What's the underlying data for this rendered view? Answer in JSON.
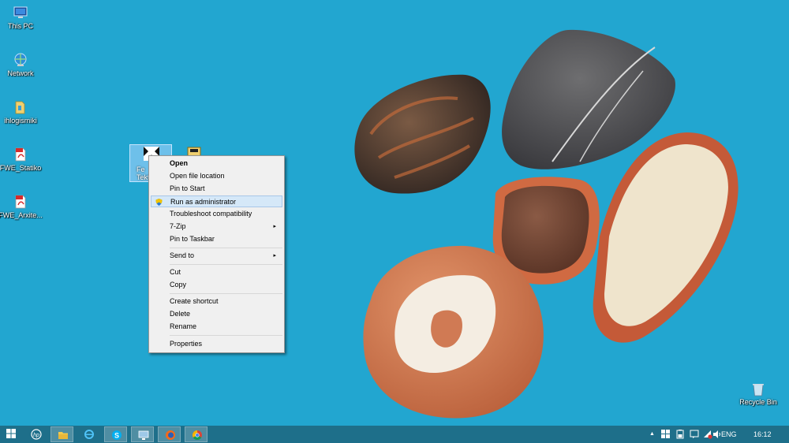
{
  "desktop": {
    "icons": [
      {
        "label": "This PC",
        "icon": "this-pc-icon"
      },
      {
        "label": "Network",
        "icon": "network-icon"
      },
      {
        "label": "ihlogismiki",
        "icon": "folder-icon"
      },
      {
        "label": "FWE_Statiko",
        "icon": "pdf-icon"
      },
      {
        "label": "FWE_Arxite...",
        "icon": "pdf-icon"
      }
    ],
    "selected_label_line1": "Fe",
    "selected_label_line2": "Tekto",
    "recycle_bin_label": "Recycle Bin"
  },
  "context_menu": {
    "items": [
      {
        "label": "Open",
        "bold": true
      },
      {
        "label": "Open file location"
      },
      {
        "label": "Pin to Start"
      },
      {
        "label": "Run as administrator",
        "highlighted": true,
        "icon": "uac-shield-icon"
      },
      {
        "label": "Troubleshoot compatibility"
      },
      {
        "label": "7-Zip",
        "submenu": true
      },
      {
        "label": "Pin to Taskbar"
      },
      {
        "label": "Send to",
        "submenu": true
      },
      {
        "label": "Cut"
      },
      {
        "label": "Copy"
      },
      {
        "label": "Create shortcut"
      },
      {
        "label": "Delete"
      },
      {
        "label": "Rename"
      },
      {
        "label": "Properties"
      }
    ],
    "submenu_arrow": "▸"
  },
  "taskbar": {
    "pinned": [
      "start-icon",
      "hp-icon",
      "file-explorer-icon",
      "ie-icon",
      "skype-icon",
      "network-monitor-icon",
      "firefox-icon",
      "chrome-icon"
    ],
    "tray": {
      "up_arrow": "▲",
      "language": "ENG",
      "time": "16:12"
    }
  },
  "colors": {
    "desktop_bg": "#22a6d0",
    "taskbar_bg": "#1e6f8a",
    "menu_bg": "#f0f0f0",
    "menu_highlight": "#d5e8f8"
  }
}
